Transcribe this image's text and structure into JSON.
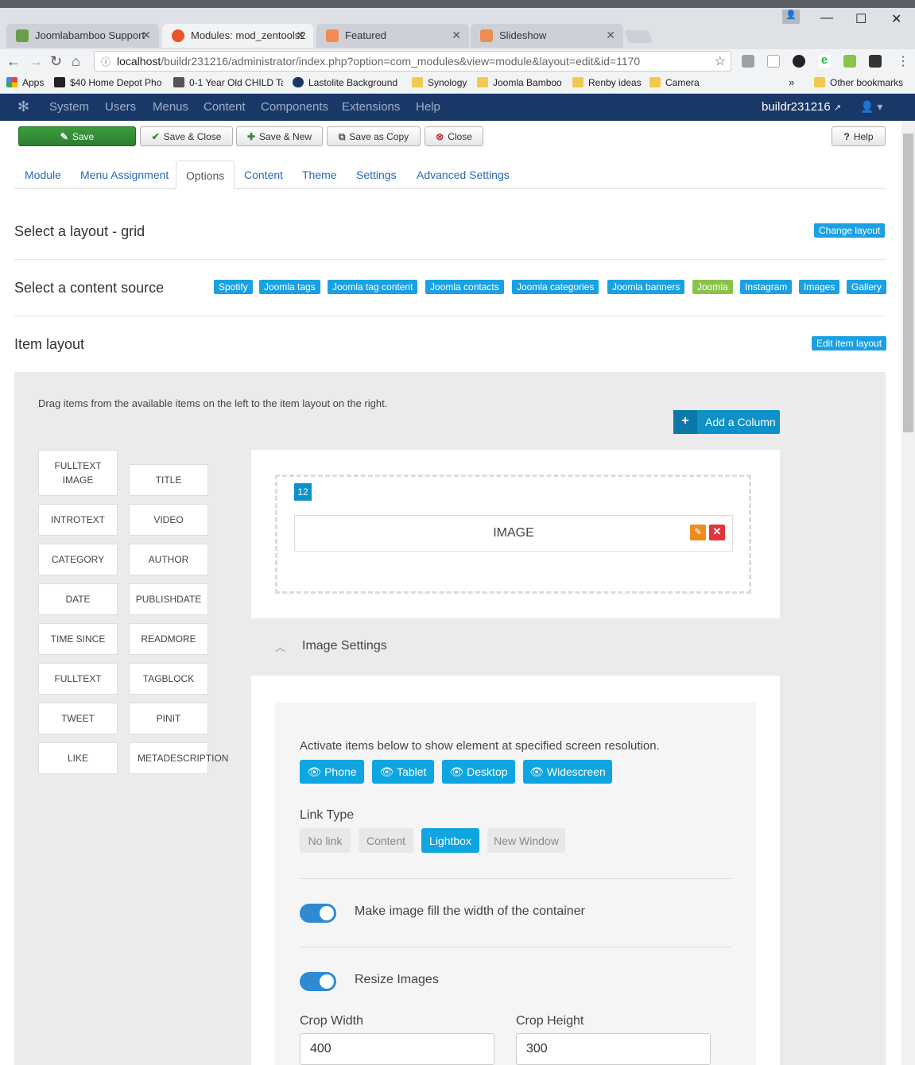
{
  "browser": {
    "tabs": [
      {
        "title": "Joomlabamboo Support",
        "icon_color": "#6a9e4f"
      },
      {
        "title": "Modules: mod_zentools2",
        "icon_color": "#f0e6d8"
      },
      {
        "title": "Featured",
        "icon_color": "#f08c52"
      },
      {
        "title": "Slideshow",
        "icon_color": "#f08c52"
      }
    ],
    "url_host": "localhost",
    "url_path": "/buildr231216/administrator/index.php?option=com_modules&view=module&layout=edit&id=1170",
    "bookmarks": [
      "Apps",
      "$40 Home Depot Pho",
      "0-1 Year Old CHILD Ta",
      "Lastolite Background",
      "Synology",
      "Joomla Bamboo",
      "Renby ideas",
      "Camera"
    ],
    "other_bookmarks": "Other bookmarks",
    "overflow": "»"
  },
  "admin": {
    "menu": [
      "System",
      "Users",
      "Menus",
      "Content",
      "Components",
      "Extensions",
      "Help"
    ],
    "site_name": "buildr231216"
  },
  "toolbar": {
    "save": "Save",
    "save_close": "Save & Close",
    "save_new": "Save & New",
    "save_copy": "Save as Copy",
    "close": "Close",
    "help": "Help"
  },
  "tabs": [
    "Module",
    "Menu Assignment",
    "Options",
    "Content",
    "Theme",
    "Settings",
    "Advanced Settings"
  ],
  "layout_section": {
    "title": "Select a layout - grid",
    "button": "Change layout"
  },
  "source_section": {
    "title": "Select a content source",
    "sources": [
      "Spotify",
      "Joomla tags",
      "Joomla tag content",
      "Joomla contacts",
      "Joomla categories",
      "Joomla banners",
      "Joomla",
      "Instagram",
      "Images",
      "Gallery"
    ],
    "active": "Joomla"
  },
  "item_layout": {
    "title": "Item layout",
    "button": "Edit item layout",
    "hint": "Drag items from the available items on the left to the item layout on the right.",
    "add_column": "Add a Column",
    "available_items": [
      "FULLTEXT IMAGE",
      "TITLE",
      "INTROTEXT",
      "VIDEO",
      "CATEGORY",
      "AUTHOR",
      "DATE",
      "PUBLISHDATE",
      "TIME SINCE",
      "READMORE",
      "FULLTEXT",
      "TAGBLOCK",
      "TWEET",
      "PINIT",
      "LIKE",
      "METADESCRIPTION"
    ],
    "column_width": "12",
    "placed_item": "IMAGE"
  },
  "image_settings": {
    "title": "Image Settings",
    "resolution_hint": "Activate items below to show element at specified screen resolution.",
    "resolutions": [
      "Phone",
      "Tablet",
      "Desktop",
      "Widescreen"
    ],
    "link_type_label": "Link Type",
    "link_types": [
      "No link",
      "Content",
      "Lightbox",
      "New Window"
    ],
    "link_type_selected": "Lightbox",
    "fill_width_label": "Make image fill the width of the container",
    "fill_width": true,
    "resize_label": "Resize Images",
    "resize": true,
    "crop_width_label": "Crop Width",
    "crop_width": "400",
    "crop_height_label": "Crop Height",
    "crop_height": "300"
  }
}
